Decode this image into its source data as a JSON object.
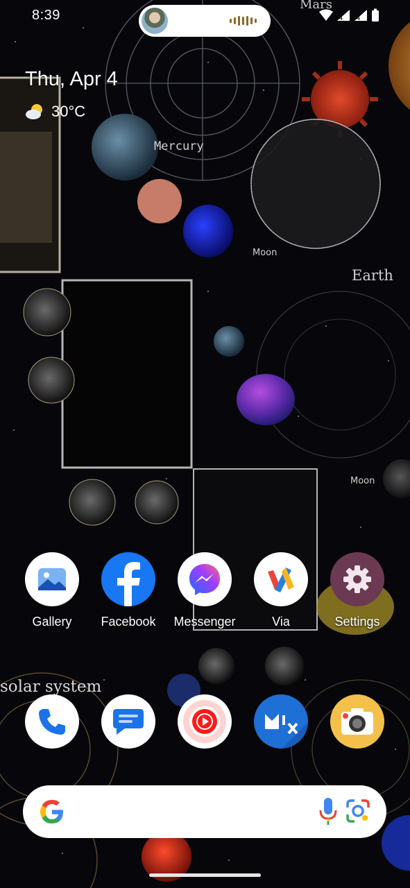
{
  "status_bar": {
    "time": "8:39"
  },
  "at_a_glance": {
    "date": "Thu, Apr 4",
    "temperature": "30°C",
    "weather_icon": "partly-sunny-icon"
  },
  "home_apps": [
    {
      "label": "Gallery",
      "icon": "gallery-icon"
    },
    {
      "label": "Facebook",
      "icon": "facebook-icon"
    },
    {
      "label": "Messenger",
      "icon": "messenger-icon"
    },
    {
      "label": "Via",
      "icon": "via-icon"
    },
    {
      "label": "Settings",
      "icon": "settings-icon"
    }
  ],
  "dock_apps": [
    {
      "icon": "phone-icon"
    },
    {
      "icon": "messages-icon"
    },
    {
      "icon": "youtube-music-icon"
    },
    {
      "icon": "mix-icon"
    },
    {
      "icon": "camera-icon"
    }
  ],
  "wallpaper_text": {
    "mars": "Mars",
    "mercury": "Mercury",
    "moon": "Moon",
    "earth": "Earth",
    "moon_2": "Moon",
    "solar_system": "solar system"
  },
  "search_bar": {
    "logo": "google-g-icon",
    "voice": "mic-icon",
    "lens": "lens-icon"
  },
  "colors": {
    "facebook": "#1877F2",
    "settings": "#6b3a52",
    "gallery": "#4a8ee8",
    "mix": "#1e6fd6",
    "camera": "#f3c14b"
  }
}
